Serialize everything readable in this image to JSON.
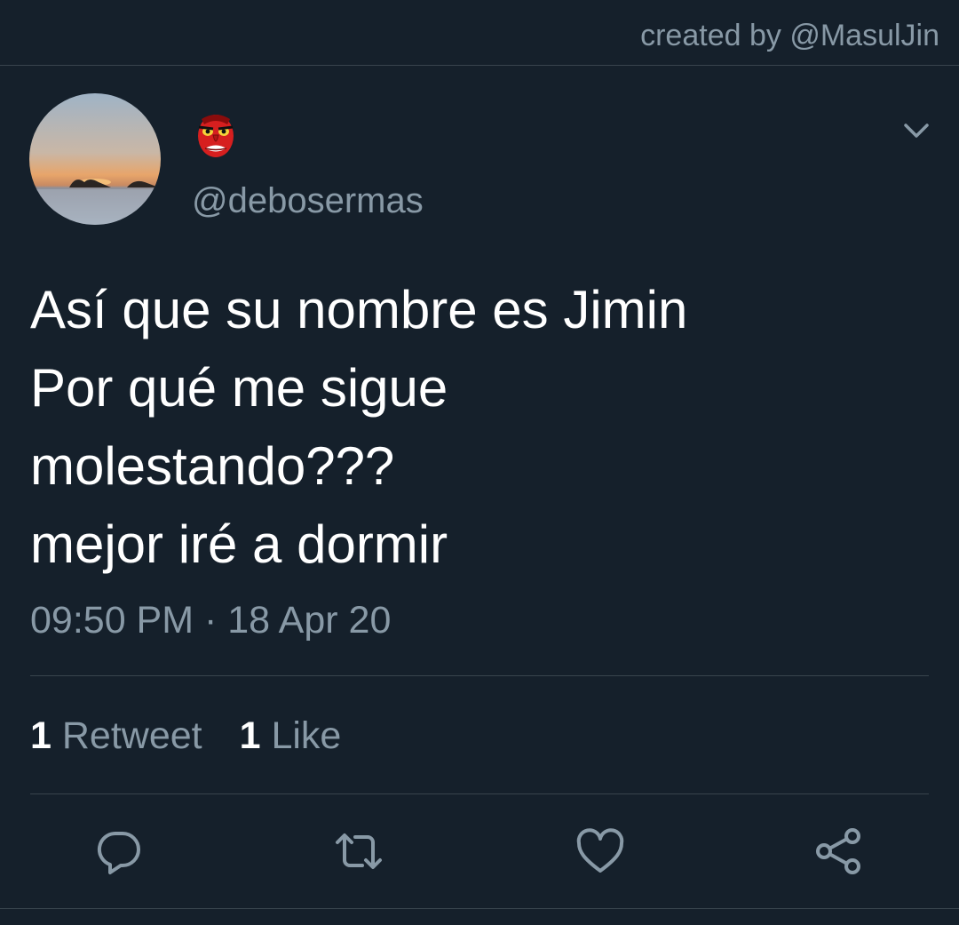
{
  "header": {
    "credit": "created by @MasulJin"
  },
  "tweet": {
    "display_name_icon": "red-tengu-mask-emoji",
    "handle": "@debosermas",
    "lines": [
      "Así que su nombre es Jimin",
      "Por qué me sigue",
      "molestando???",
      "mejor iré a dormir"
    ],
    "timestamp": "09:50 PM · 18 Apr 20"
  },
  "stats": {
    "retweets_count": "1",
    "retweets_label": "Retweet",
    "likes_count": "1",
    "likes_label": "Like"
  },
  "actions": [
    "reply-icon",
    "retweet-icon",
    "like-icon",
    "share-icon"
  ],
  "colors": {
    "background": "#15202b",
    "secondary_text": "#8899a6",
    "divider": "#38444d"
  }
}
